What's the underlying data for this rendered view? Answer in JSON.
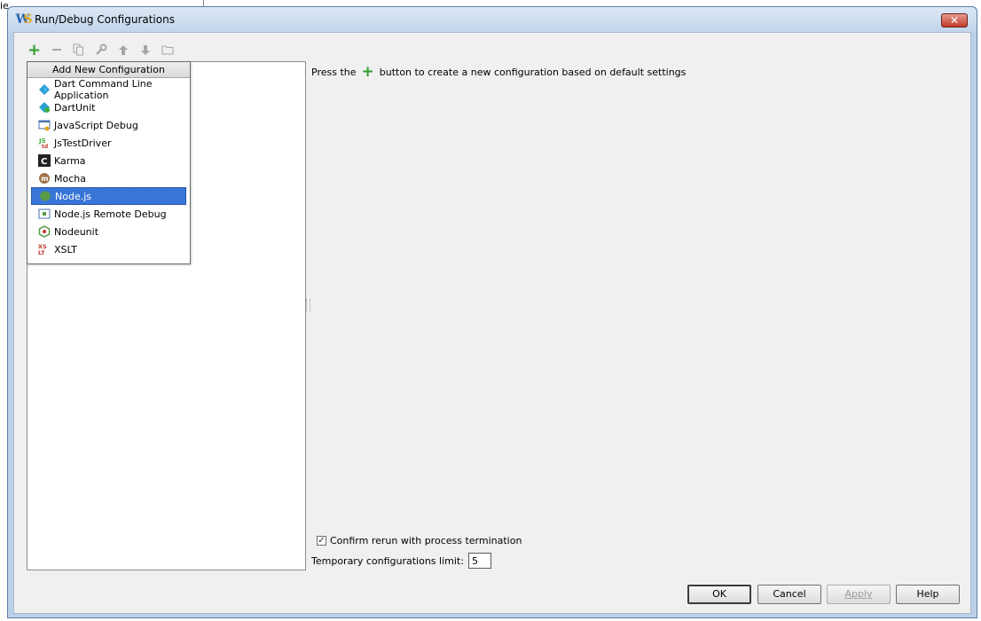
{
  "background": {
    "edge_text": "ie"
  },
  "window": {
    "title": "Run/Debug Configurations",
    "close_glyph": "✕"
  },
  "toolbar": {
    "add_icon": "plus-icon",
    "remove_icon": "minus-icon",
    "copy_icon": "copy-icon",
    "edit_defaults_icon": "wrench-icon",
    "move_up_icon": "arrow-up-icon",
    "move_down_icon": "arrow-down-icon",
    "folder_icon": "folder-icon"
  },
  "popup": {
    "header": "Add New Configuration",
    "items": [
      {
        "label": "Dart Command Line Application",
        "icon": "dart-icon",
        "selected": false
      },
      {
        "label": "DartUnit",
        "icon": "dartunit-icon",
        "selected": false
      },
      {
        "label": "JavaScript Debug",
        "icon": "javascript-debug-icon",
        "selected": false
      },
      {
        "label": "JsTestDriver",
        "icon": "jstestdriver-icon",
        "selected": false
      },
      {
        "label": "Karma",
        "icon": "karma-icon",
        "selected": false
      },
      {
        "label": "Mocha",
        "icon": "mocha-icon",
        "selected": false
      },
      {
        "label": "Node.js",
        "icon": "nodejs-icon",
        "selected": true
      },
      {
        "label": "Node.js Remote Debug",
        "icon": "nodejs-remote-debug-icon",
        "selected": false
      },
      {
        "label": "Nodeunit",
        "icon": "nodeunit-icon",
        "selected": false
      },
      {
        "label": "XSLT",
        "icon": "xslt-icon",
        "selected": false
      }
    ]
  },
  "hint": {
    "prefix": "Press the",
    "suffix": "button to create a new configuration based on default settings"
  },
  "options": {
    "confirm_rerun_label": "Confirm rerun with process termination",
    "confirm_rerun_checked": true,
    "temp_limit_label": "Temporary configurations limit:",
    "temp_limit_value": "5"
  },
  "buttons": {
    "ok": "OK",
    "cancel": "Cancel",
    "apply": "Apply",
    "help": "Help"
  },
  "colors": {
    "selection": "#3875d7",
    "add_green": "#2d9e2d",
    "dialog_bg": "#f0f0f0"
  }
}
